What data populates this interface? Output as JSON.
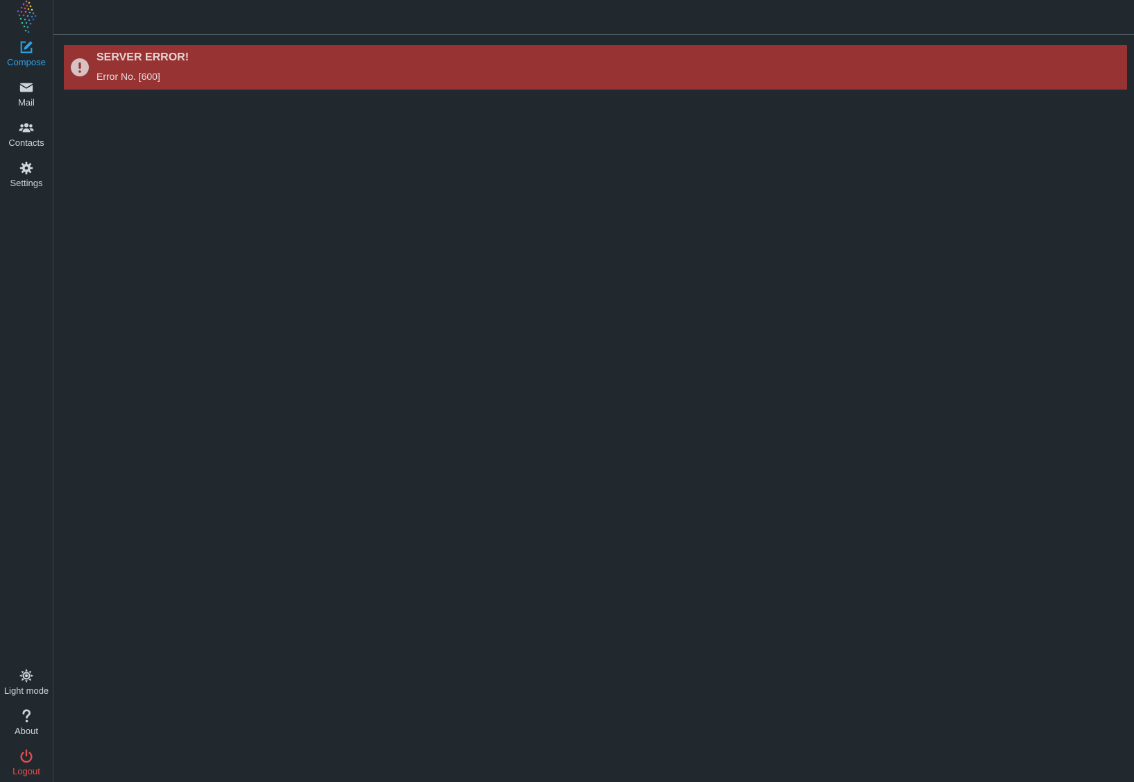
{
  "sidebar": {
    "logo_icon": "app-logo-icon",
    "nav": [
      {
        "label": "Compose",
        "icon": "edit-icon",
        "active": true
      },
      {
        "label": "Mail",
        "icon": "envelope-icon"
      },
      {
        "label": "Contacts",
        "icon": "users-icon"
      },
      {
        "label": "Settings",
        "icon": "gear-icon"
      }
    ],
    "bottom": [
      {
        "label": "Light mode",
        "icon": "sun-icon"
      },
      {
        "label": "About",
        "icon": "question-icon"
      },
      {
        "label": "Logout",
        "icon": "power-icon"
      }
    ]
  },
  "alert": {
    "title": "SERVER ERROR!",
    "message": "Error No. [600]",
    "icon": "exclamation-circle-icon"
  },
  "colors": {
    "background": "#22292e",
    "active": "#2ba4ec",
    "logout": "#e74c4c",
    "alert_bg": "#983333",
    "divider": "#58636a"
  }
}
